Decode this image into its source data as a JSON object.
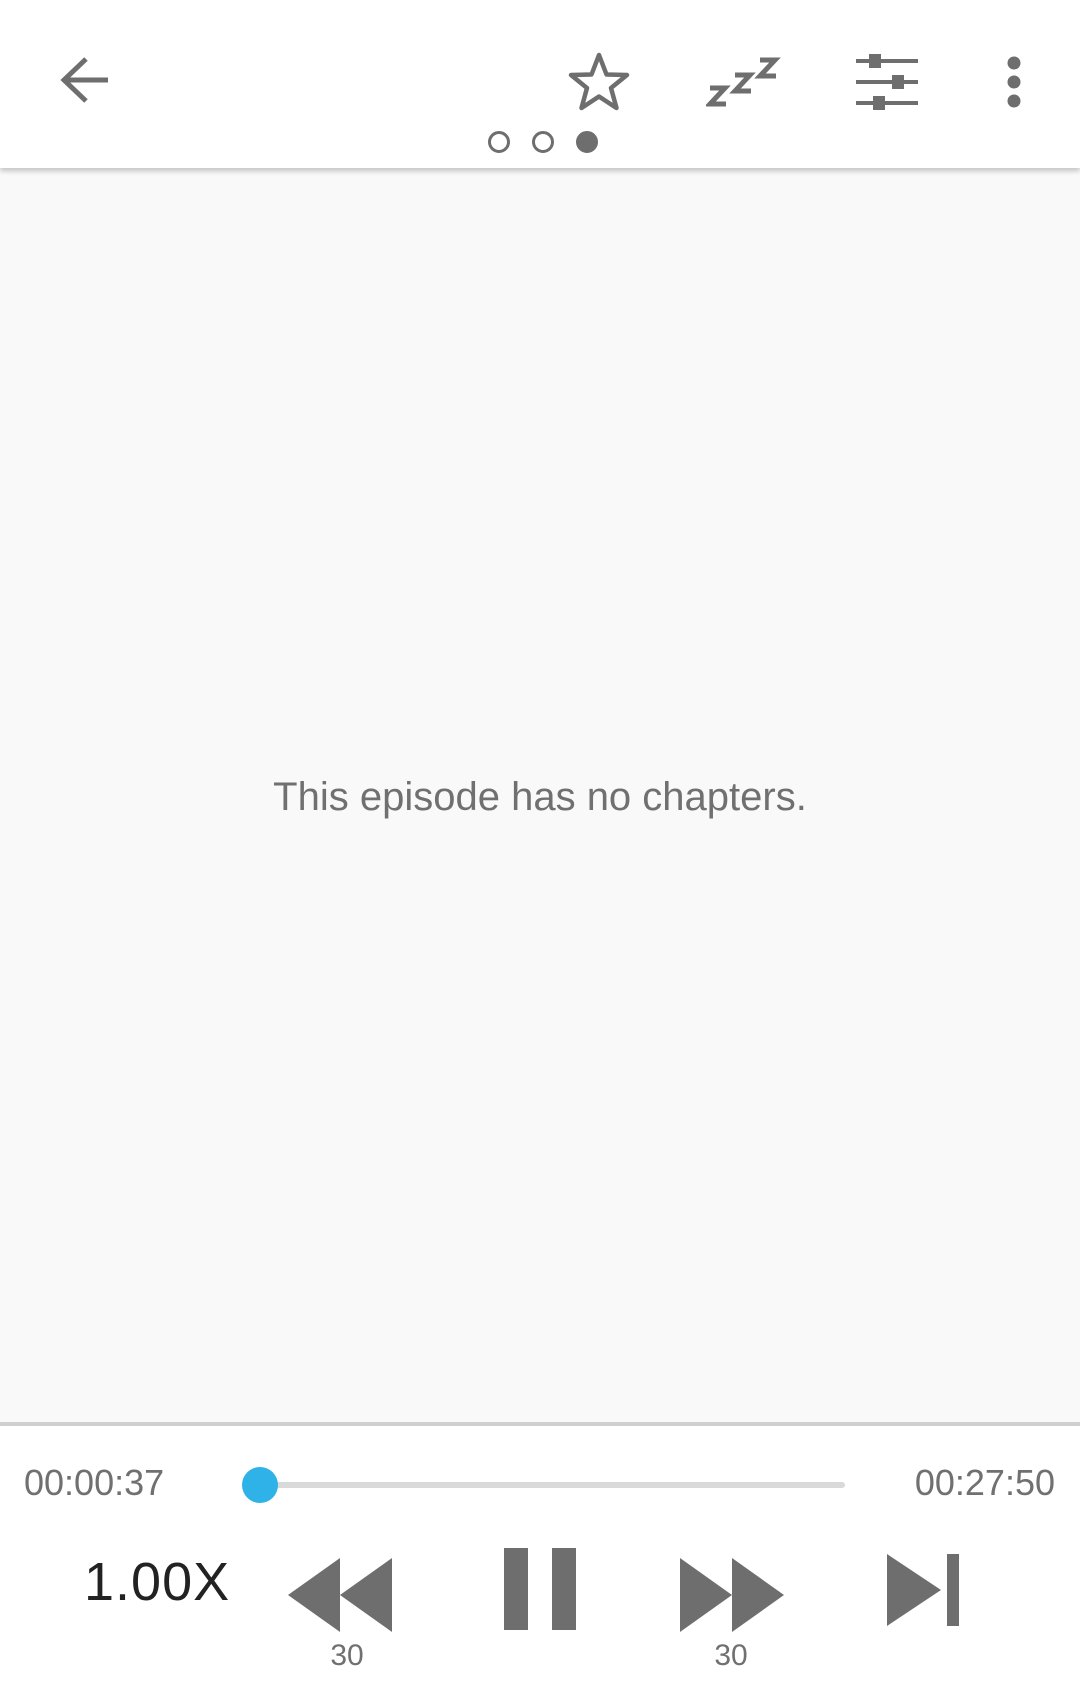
{
  "toolbar": {
    "back_icon": "arrow-left-icon",
    "favorite_icon": "star-outline-icon",
    "sleep_timer_icon": "sleep-zzz-icon",
    "audio_settings_icon": "sliders-icon",
    "more_icon": "more-vertical-icon",
    "page_indicator": {
      "count": 3,
      "active_index": 2
    }
  },
  "content": {
    "empty_message": "This episode has no chapters."
  },
  "player": {
    "current_time": "00:00:37",
    "total_time": "00:27:50",
    "progress_fraction": 0.022,
    "speed": "1.00X",
    "rewind_seconds": "30",
    "fast_forward_seconds": "30",
    "rewind_icon": "rewind-icon",
    "pause_icon": "pause-icon",
    "fast_forward_icon": "fast-forward-icon",
    "skip_icon": "skip-next-icon"
  },
  "colors": {
    "accent": "#2fb2e8",
    "icon": "#6e6e6e",
    "text_secondary": "#707070",
    "background": "#f9f9f9"
  }
}
